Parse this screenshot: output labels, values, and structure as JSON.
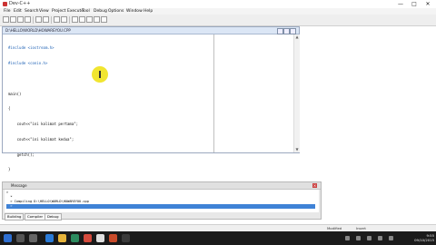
{
  "window": {
    "title": "Dev-C++",
    "controls": {
      "minimize": "—",
      "maximize": "□",
      "close": "✕"
    }
  },
  "menu": [
    "File",
    "Edit",
    "Search",
    "View",
    "Project",
    "Execute",
    "Tool",
    "Debug",
    "Options",
    "Window",
    "Help"
  ],
  "editor": {
    "title": "D:\\HELLO\\WORLD\\HOWAREYOU.CPP",
    "code_lines": [
      "#include <iostream.h>",
      "#include <conio.h>",
      "",
      "main()",
      "{",
      "    cout<<\"ini kalimat pertama\";",
      "    cout<<\"ini kalimat kedua\";",
      "    getch();",
      "}"
    ]
  },
  "messages": {
    "title": "Message",
    "lines": [
      "> ",
      "  * ",
      "  > Compiling D:\\HELLO\\WORLD\\HOWAREYOU.cpp",
      "  > "
    ],
    "tabs": [
      "Building",
      "Compiler",
      "Debug"
    ]
  },
  "status": {
    "left": "",
    "position": "",
    "mode": "Modified",
    "encoding": "Insert",
    "size": ""
  },
  "taskbar": {
    "time": "9:55",
    "date": "09/10/2015"
  },
  "colors": {
    "accent": "#3f82d6",
    "cursor_highlight": "#f0e21a",
    "include_color": "#1b5fb4"
  }
}
